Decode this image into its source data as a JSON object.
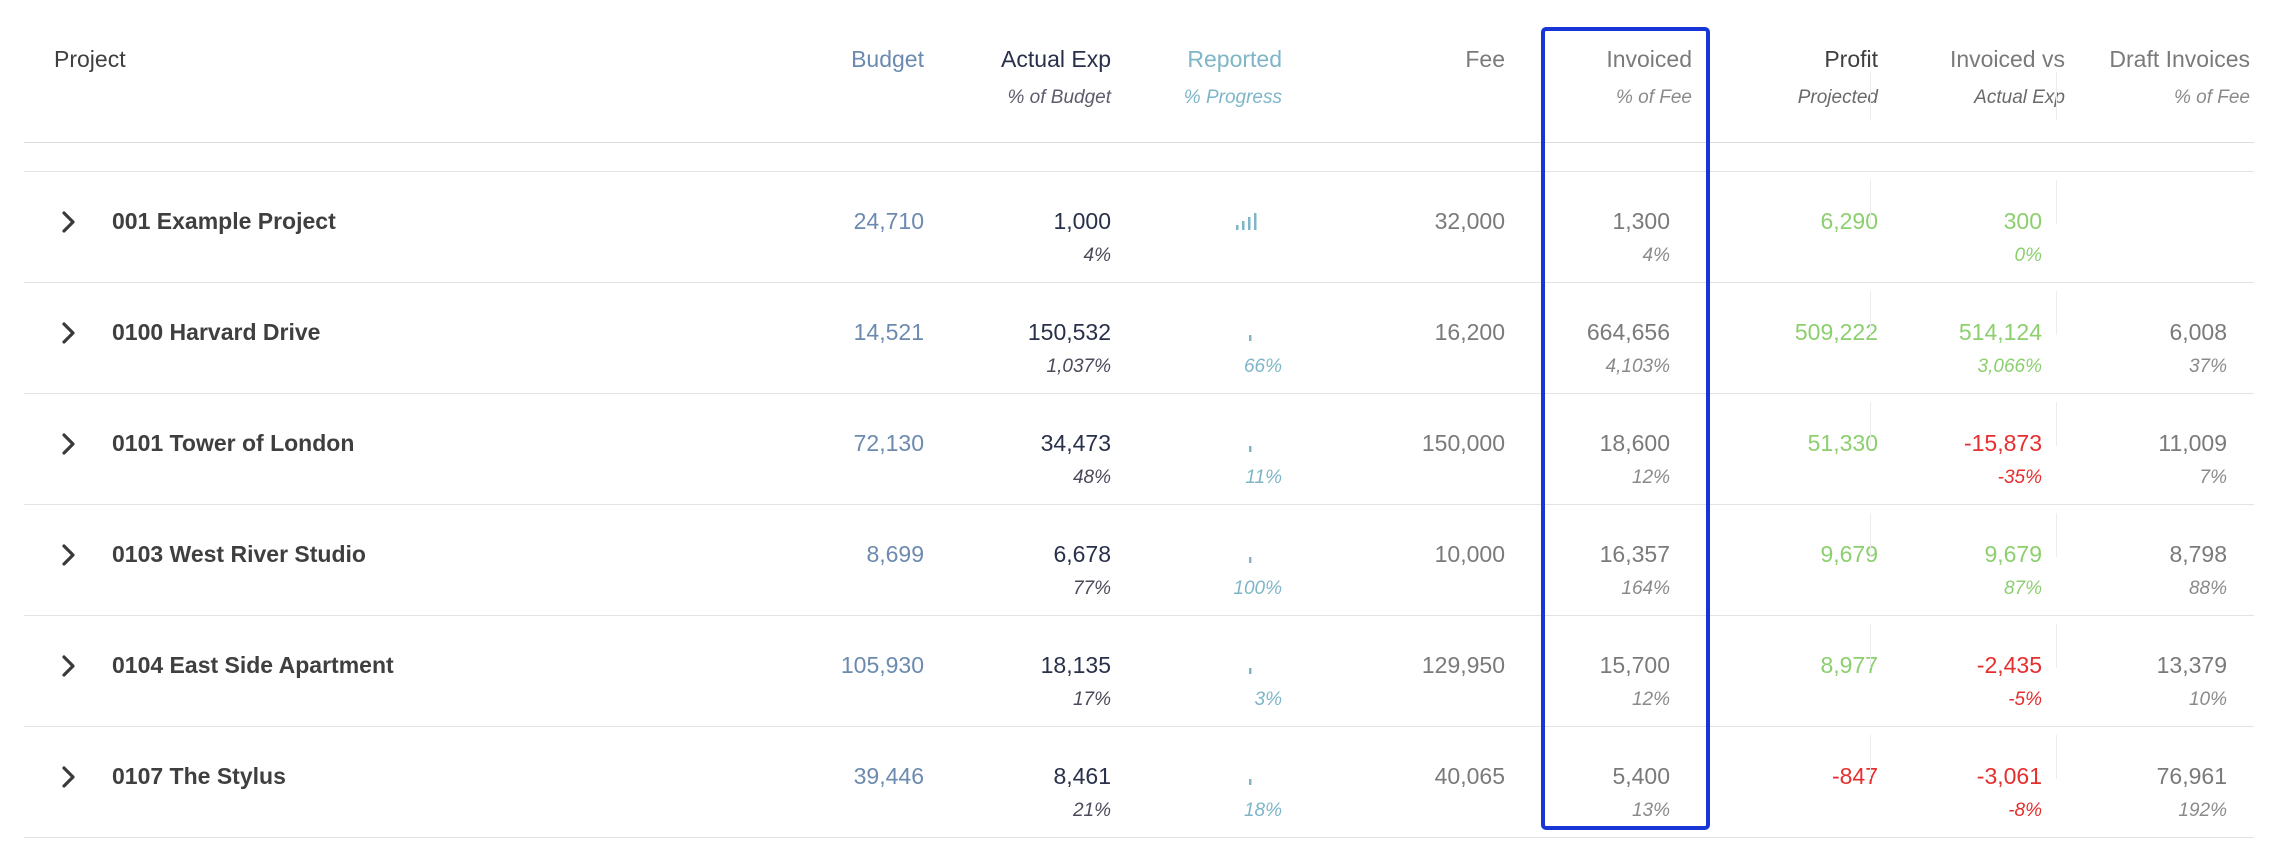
{
  "columns": {
    "project": {
      "title": "Project"
    },
    "budget": {
      "title": "Budget"
    },
    "actual_exp": {
      "title": "Actual Exp",
      "sub": "% of Budget"
    },
    "reported": {
      "title": "Reported",
      "sub": "% Progress"
    },
    "fee": {
      "title": "Fee"
    },
    "invoiced": {
      "title": "Invoiced",
      "sub": "% of Fee"
    },
    "profit": {
      "title": "Profit",
      "sub": "Projected"
    },
    "inv_vs": {
      "title": "Invoiced vs",
      "sub": "Actual Exp"
    },
    "draft": {
      "title": "Draft Invoices",
      "sub": "% of Fee"
    }
  },
  "colors": {
    "budget": "#6c8ab0",
    "actual": "#28304a",
    "reported": "#7eb6c8",
    "muted": "#7a7a7a",
    "positive": "#8ccf6e",
    "negative": "#e62e2e",
    "highlight": "#1836d6"
  },
  "expand_icon": "chevron-right-icon",
  "progress_icon": "signal-bars-icon",
  "rows": [
    {
      "project": "001 Example Project",
      "budget": "24,710",
      "actual": "1,000",
      "actual_pct": "4%",
      "reported_pct": "",
      "fee": "32,000",
      "invoiced": "1,300",
      "invoiced_pct": "4%",
      "profit": "6,290",
      "profit_sign": "positive",
      "inv_vs": "300",
      "inv_vs_pct": "0%",
      "inv_vs_sign": "positive",
      "draft": "",
      "draft_pct": ""
    },
    {
      "project": "0100 Harvard Drive",
      "budget": "14,521",
      "actual": "150,532",
      "actual_pct": "1,037%",
      "reported_pct": "66%",
      "fee": "16,200",
      "invoiced": "664,656",
      "invoiced_pct": "4,103%",
      "profit": "509,222",
      "profit_sign": "positive",
      "inv_vs": "514,124",
      "inv_vs_pct": "3,066%",
      "inv_vs_sign": "positive",
      "draft": "6,008",
      "draft_pct": "37%"
    },
    {
      "project": "0101 Tower of London",
      "budget": "72,130",
      "actual": "34,473",
      "actual_pct": "48%",
      "reported_pct": "11%",
      "fee": "150,000",
      "invoiced": "18,600",
      "invoiced_pct": "12%",
      "profit": "51,330",
      "profit_sign": "positive",
      "inv_vs": "-15,873",
      "inv_vs_pct": "-35%",
      "inv_vs_sign": "negative",
      "draft": "11,009",
      "draft_pct": "7%"
    },
    {
      "project": "0103 West River Studio",
      "budget": "8,699",
      "actual": "6,678",
      "actual_pct": "77%",
      "reported_pct": "100%",
      "fee": "10,000",
      "invoiced": "16,357",
      "invoiced_pct": "164%",
      "profit": "9,679",
      "profit_sign": "positive",
      "inv_vs": "9,679",
      "inv_vs_pct": "87%",
      "inv_vs_sign": "positive",
      "draft": "8,798",
      "draft_pct": "88%"
    },
    {
      "project": "0104 East Side Apartment",
      "budget": "105,930",
      "actual": "18,135",
      "actual_pct": "17%",
      "reported_pct": "3%",
      "fee": "129,950",
      "invoiced": "15,700",
      "invoiced_pct": "12%",
      "profit": "8,977",
      "profit_sign": "positive",
      "inv_vs": "-2,435",
      "inv_vs_pct": "-5%",
      "inv_vs_sign": "negative",
      "draft": "13,379",
      "draft_pct": "10%"
    },
    {
      "project": "0107 The Stylus",
      "budget": "39,446",
      "actual": "8,461",
      "actual_pct": "21%",
      "reported_pct": "18%",
      "fee": "40,065",
      "invoiced": "5,400",
      "invoiced_pct": "13%",
      "profit": "-847",
      "profit_sign": "negative",
      "inv_vs": "-3,061",
      "inv_vs_pct": "-8%",
      "inv_vs_sign": "negative",
      "draft": "76,961",
      "draft_pct": "192%"
    }
  ]
}
